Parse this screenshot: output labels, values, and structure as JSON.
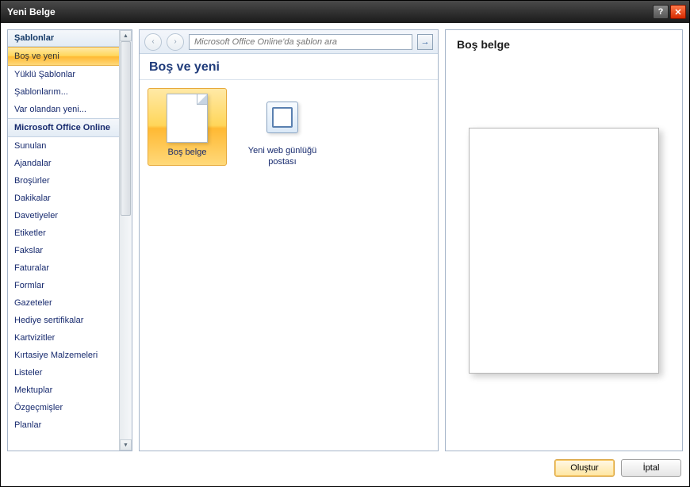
{
  "window": {
    "title": "Yeni Belge"
  },
  "sidebar": {
    "header": "Şablonlar",
    "items": [
      {
        "label": "Boş ve yeni",
        "selected": true
      },
      {
        "label": "Yüklü Şablonlar"
      },
      {
        "label": "Şablonlarım..."
      },
      {
        "label": "Var olandan yeni..."
      },
      {
        "label": "Microsoft Office Online",
        "section": true
      },
      {
        "label": "Sunulan"
      },
      {
        "label": "Ajandalar"
      },
      {
        "label": "Broşürler"
      },
      {
        "label": "Dakikalar"
      },
      {
        "label": "Davetiyeler"
      },
      {
        "label": "Etiketler"
      },
      {
        "label": "Fakslar"
      },
      {
        "label": "Faturalar"
      },
      {
        "label": "Formlar"
      },
      {
        "label": "Gazeteler"
      },
      {
        "label": "Hediye sertifikalar"
      },
      {
        "label": "Kartvizitler"
      },
      {
        "label": "Kırtasiye Malzemeleri"
      },
      {
        "label": "Listeler"
      },
      {
        "label": "Mektuplar"
      },
      {
        "label": "Özgeçmişler"
      },
      {
        "label": "Planlar"
      }
    ]
  },
  "search": {
    "placeholder": "Microsoft Office Online'da şablon ara"
  },
  "middle": {
    "heading": "Boş ve yeni",
    "templates": [
      {
        "label": "Boş belge",
        "kind": "blank",
        "selected": true
      },
      {
        "label": "Yeni web günlüğü postası",
        "kind": "blog"
      }
    ]
  },
  "preview": {
    "title": "Boş belge"
  },
  "buttons": {
    "create": "Oluştur",
    "cancel": "İptal"
  },
  "icons": {
    "back": "‹",
    "forward": "›",
    "go": "→",
    "up": "▲",
    "down": "▼",
    "close": "✕",
    "help": "?"
  }
}
